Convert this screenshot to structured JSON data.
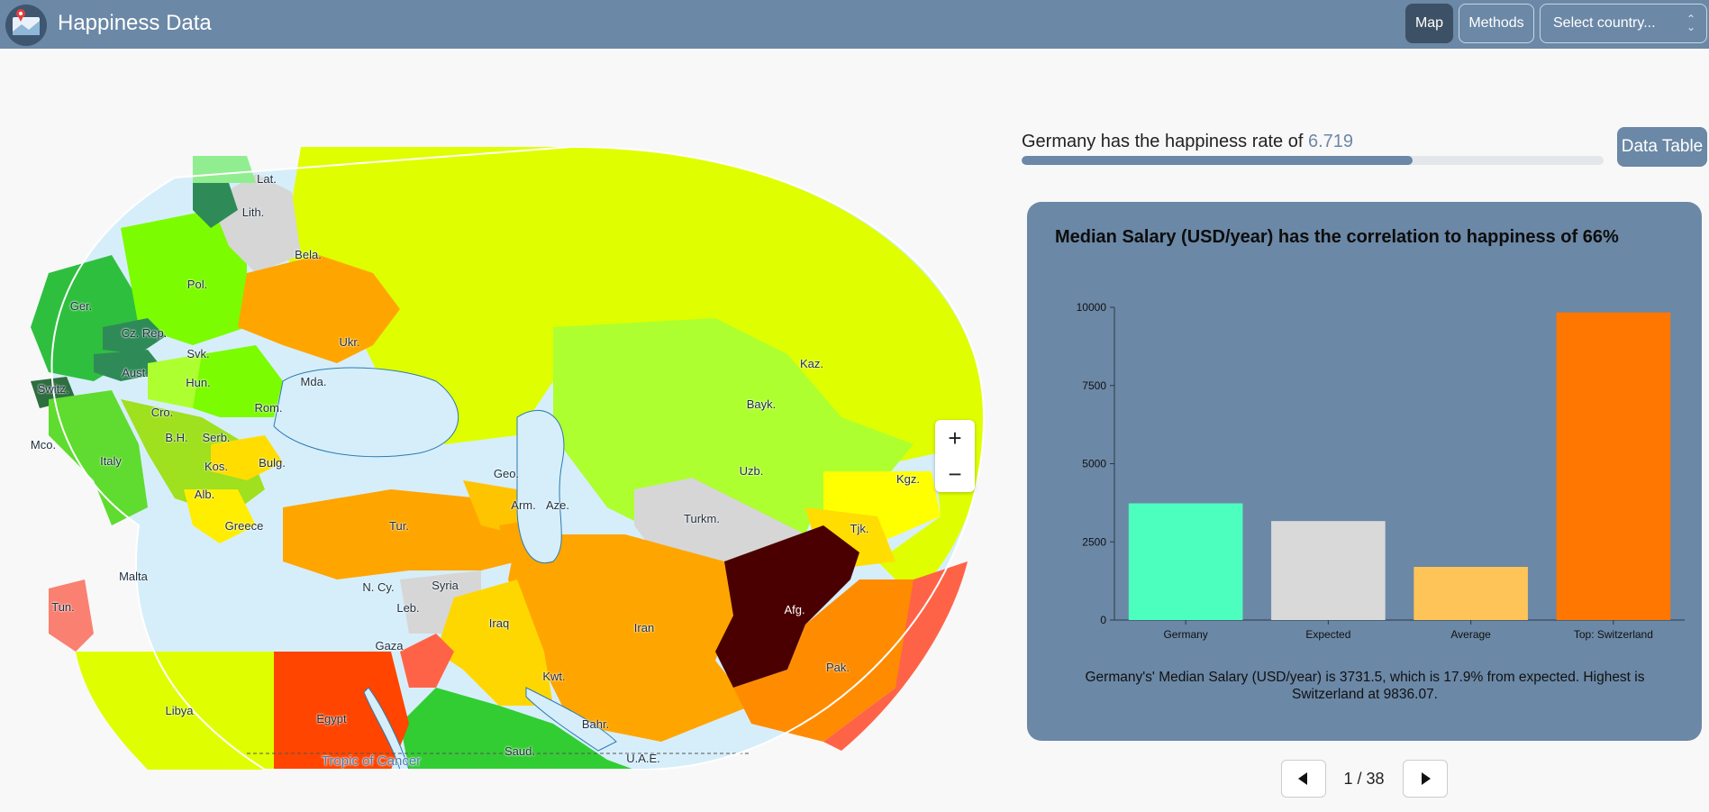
{
  "header": {
    "title": "Happiness Data",
    "nav": {
      "map": "Map",
      "methods": "Methods"
    },
    "select_placeholder": "Select country..."
  },
  "map": {
    "labels": {
      "lat": "Lat.",
      "lith": "Lith.",
      "bela": "Bela.",
      "pol": "Pol.",
      "ger": "Ger.",
      "czrep": "Cz. Rep.",
      "svk": "Svk.",
      "aust": "Aust.",
      "hun": "Hun.",
      "switz": "Switz.",
      "mda": "Mda.",
      "rom": "Rom.",
      "cro": "Cro.",
      "ukr": "Ukr.",
      "mco": "Mco.",
      "bh": "B.H.",
      "serb": "Serb.",
      "italy": "Italy",
      "kos": "Kos.",
      "bulg": "Bulg.",
      "alb": "Alb.",
      "greece": "Greece",
      "malta": "Malta",
      "tun": "Tun.",
      "libya": "Libya",
      "egypt": "Egypt",
      "gaza": "Gaza",
      "ncy": "N. Cy.",
      "leb": "Leb.",
      "syria": "Syria",
      "iraq": "Iraq",
      "tur": "Tur.",
      "geo": "Geo.",
      "arm": "Arm.",
      "aze": "Aze.",
      "turkm": "Turkm.",
      "iran": "Iran",
      "afg": "Afg.",
      "pak": "Pak.",
      "kwt": "Kwt.",
      "bahr": "Bahr.",
      "uae": "U.A.E.",
      "saud": "Saud.",
      "kaz": "Kaz.",
      "bayk": "Bayk.",
      "uzb": "Uzb.",
      "kgz": "Kgz.",
      "tjk": "Tjk.",
      "tropic": "Tropic of Cancer"
    },
    "zoom_in": "+",
    "zoom_out": "−",
    "colors": {
      "water": "#d6eefa",
      "border": "#2b7bb0",
      "no_data": "#d6d6d6"
    }
  },
  "summary": {
    "prefix": "Germany has the happiness rate of ",
    "rate": "6.719",
    "progress_fraction": 0.6719,
    "data_table_label": "Data Table"
  },
  "card": {
    "title": "Median Salary (USD/year) has the correlation to happiness of 66%",
    "description": "Germany's' Median Salary (USD/year) is 3731.5, which is 17.9% from expected. Highest is Switzerland at 9836.07."
  },
  "chart_data": {
    "type": "bar",
    "categories": [
      "Germany",
      "Expected",
      "Average",
      "Top: Switzerland"
    ],
    "values": [
      3731.5,
      3165,
      1700,
      9836.07
    ],
    "colors": [
      "#4dffbe",
      "#d9d9d9",
      "#ffc457",
      "#ff7700"
    ],
    "yticks": [
      "0",
      "2500",
      "5000",
      "7500",
      "10000"
    ],
    "ylim": [
      0,
      10000
    ]
  },
  "pager": {
    "text": "1 / 38"
  }
}
